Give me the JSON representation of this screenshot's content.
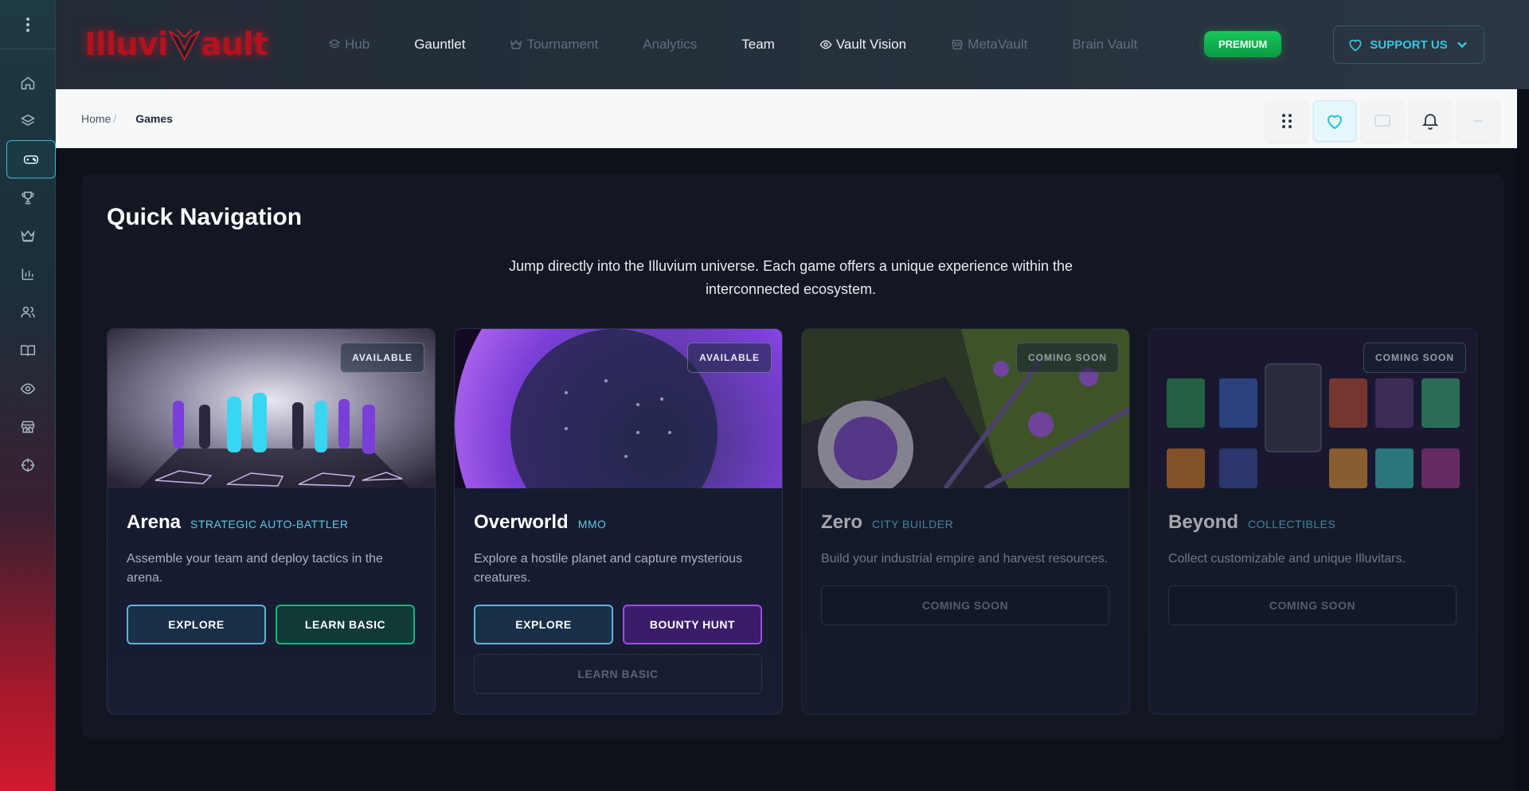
{
  "app": {
    "logo_text_left": "Illuvi",
    "logo_text_right": "ault"
  },
  "nav": [
    {
      "label": "Hub",
      "icon": "layers-icon",
      "dim": true
    },
    {
      "label": "Gauntlet",
      "icon": "",
      "dim": false
    },
    {
      "label": "Tournament",
      "icon": "crown-icon",
      "dim": true
    },
    {
      "label": "Analytics",
      "icon": "",
      "dim": true
    },
    {
      "label": "Team",
      "icon": "",
      "dim": false
    },
    {
      "label": "Vault Vision",
      "icon": "eye-icon",
      "dim": false
    },
    {
      "label": "MetaVault",
      "icon": "store-icon",
      "dim": true
    },
    {
      "label": "Brain Vault",
      "icon": "",
      "dim": true
    }
  ],
  "header": {
    "premium_label": "PREMIUM",
    "support_label": "SUPPORT US"
  },
  "breadcrumb": {
    "home": "Home",
    "separator": "/",
    "current": "Games"
  },
  "sidebar": {
    "items": [
      "home-icon",
      "layers-icon",
      "gamepad-icon",
      "trophy-icon",
      "crown-icon",
      "chart-icon",
      "users-icon",
      "book-icon",
      "eye-icon",
      "store-icon",
      "crosshair-icon"
    ],
    "active": "gamepad-icon"
  },
  "main": {
    "title": "Quick Navigation",
    "description": "Jump directly into the Illuvium universe. Each game offers a unique experience within the interconnected ecosystem."
  },
  "cards": [
    {
      "name": "Arena",
      "tag": "STRATEGIC AUTO-BATTLER",
      "status": "AVAILABLE",
      "description": "Assemble your team and deploy tactics in the arena.",
      "buttons": [
        "EXPLORE",
        "LEARN BASIC"
      ]
    },
    {
      "name": "Overworld",
      "tag": "MMO",
      "status": "AVAILABLE",
      "description": "Explore a hostile planet and capture mysterious creatures.",
      "buttons": [
        "EXPLORE",
        "BOUNTY HUNT",
        "LEARN BASIC"
      ]
    },
    {
      "name": "Zero",
      "tag": "CITY BUILDER",
      "status": "COMING SOON",
      "description": "Build your industrial empire and harvest resources.",
      "buttons": [
        "COMING SOON"
      ]
    },
    {
      "name": "Beyond",
      "tag": "COLLECTIBLES",
      "status": "COMING SOON",
      "description": "Collect customizable and unique Illuvitars.",
      "buttons": [
        "COMING SOON"
      ]
    }
  ],
  "colors": {
    "accent": "#38c6e0",
    "premium": "#16c75a",
    "learn": "#16b67c",
    "bounty": "#9b4fe0",
    "brand_red": "#b4121e"
  }
}
